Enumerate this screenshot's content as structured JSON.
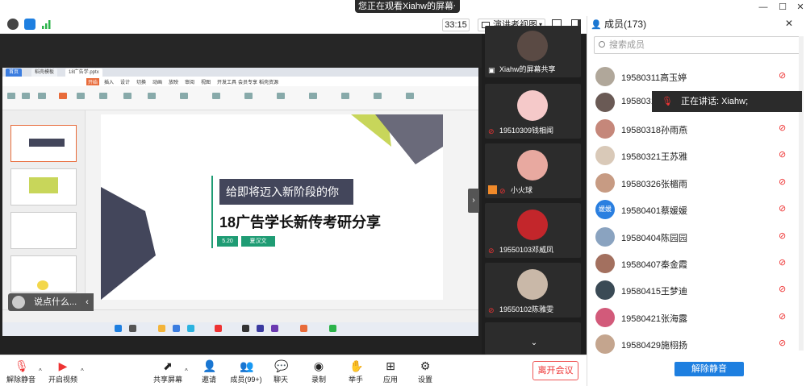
{
  "top_banner": {
    "text": "您正在观看Xiahw的屏幕",
    "more": "⋯"
  },
  "window_controls": {
    "minimize": "—",
    "maximize": "☐",
    "close": "✕"
  },
  "toolbar": {
    "timer": "33:15",
    "view_label": "演讲者视图"
  },
  "shared_screen": {
    "tabs": [
      "首页",
      "稻壳模板",
      "18广告学.pptx"
    ],
    "menu": [
      "开始",
      "插入",
      "设计",
      "切换",
      "动画",
      "放映",
      "审阅",
      "视图",
      "开发工具",
      "会员专享",
      "稻壳资源"
    ],
    "slide_title": "给即将迈入新阶段的你",
    "slide_subtitle": "18广告学长新传考研分享",
    "slide_date": "5.20",
    "slide_name": "夏汉文",
    "chat_preview": "说点什么..."
  },
  "video_tiles": [
    {
      "name": "Xiahw的屏幕共享"
    },
    {
      "name": "19510309钱相闻"
    },
    {
      "name": "小火球"
    },
    {
      "name": "19550103邓威凤"
    },
    {
      "name": "19550102陈雅雯"
    }
  ],
  "members_panel": {
    "title": "成员(173)",
    "search_placeholder": "搜索成员",
    "speaking": "正在讲话: Xiahw;",
    "unmute_all": "解除静音",
    "members": [
      {
        "name": "19580311高玉婷",
        "avatar_color": "#b0a79a"
      },
      {
        "name": "19580312",
        "avatar_color": "#6a5a55"
      },
      {
        "name": "19580318孙雨燕",
        "avatar_color": "#c5877a"
      },
      {
        "name": "19580321王苏雅",
        "avatar_color": "#d9c9b8"
      },
      {
        "name": "19580326张楣雨",
        "avatar_color": "#c79b83"
      },
      {
        "name": "19580401蔡媛媛",
        "avatar_color": "#2a7fe0",
        "avatar_text": "媛媛"
      },
      {
        "name": "19580404陈园园",
        "avatar_color": "#8aa3c0"
      },
      {
        "name": "19580407秦金霞",
        "avatar_color": "#a3705f"
      },
      {
        "name": "19580415王梦迪",
        "avatar_color": "#3a4a55"
      },
      {
        "name": "19580421张海露",
        "avatar_color": "#d25a7a"
      },
      {
        "name": "19580429施栩扬",
        "avatar_color": "#c4a58e"
      }
    ]
  },
  "controls": {
    "unmute": "解除静音",
    "start_video": "开启视频",
    "share_screen": "共享屏幕",
    "invite": "邀请",
    "members": "成员(99+)",
    "chat": "聊天",
    "record": "录制",
    "raise_hand": "举手",
    "apps": "应用",
    "settings": "设置",
    "leave": "离开会议"
  },
  "colors": {
    "accent": "#1e7fe0",
    "leave": "#e33333",
    "slide_green": "#1f9c74",
    "slide_dark": "#43465b"
  }
}
